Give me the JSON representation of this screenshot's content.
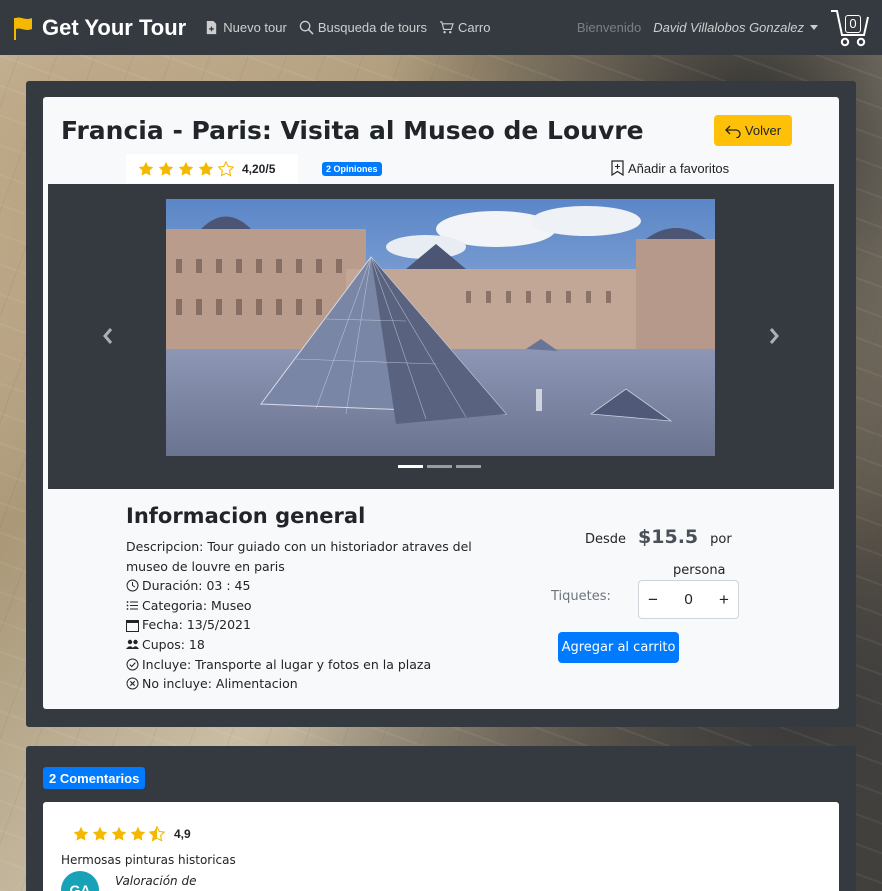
{
  "navbar": {
    "brand": "Get Your Tour",
    "links": [
      {
        "label": "Nuevo tour",
        "icon": "file-plus-icon"
      },
      {
        "label": "Busqueda de tours",
        "icon": "search-icon"
      },
      {
        "label": "Carro",
        "icon": "cart-icon"
      }
    ],
    "welcome": "Bienvenido",
    "user": "David Villalobos Gonzalez",
    "cart_count": "0"
  },
  "tour": {
    "title": "Francia - Paris: Visita al Museo de Louvre",
    "back_label": "Volver",
    "rating": "4,20/5",
    "stars": 4.2,
    "opinions_label": "2 Opiniones",
    "favorite_label": "Añadir a favoritos"
  },
  "carousel": {
    "slides": 3,
    "active_slide": 1
  },
  "info": {
    "heading": "Informacion general",
    "description": "Descripcion: Tour guiado con un historiador atraves del museo de louvre en paris",
    "duration": "Duración: 03 : 45",
    "category": "Categoria: Museo",
    "date": "Fecha: 13/5/2021",
    "spots": "Cupos: 18",
    "includes": "Incluye: Transporte al lugar y fotos en la plaza",
    "excludes": "No incluye: Alimentacion"
  },
  "purchase": {
    "from_label": "Desde",
    "price": "$15.5",
    "per_label": "por",
    "person_label": "persona",
    "tickets_label": "Tiquetes:",
    "minus": "−",
    "plus": "+",
    "ticket_value": "0",
    "add_label": "Agregar al carrito"
  },
  "comments": {
    "badge": "2 Comentarios",
    "items": [
      {
        "rating": "4,9",
        "stars": 4.9,
        "text": "Hermosas pinturas historicas",
        "avatar": "GA",
        "valoracion": "Valoración de"
      }
    ]
  },
  "colors": {
    "navbar": "#343a40",
    "accent_yellow": "#ffc107",
    "primary_blue": "#007bff",
    "star": "#f5b800"
  }
}
